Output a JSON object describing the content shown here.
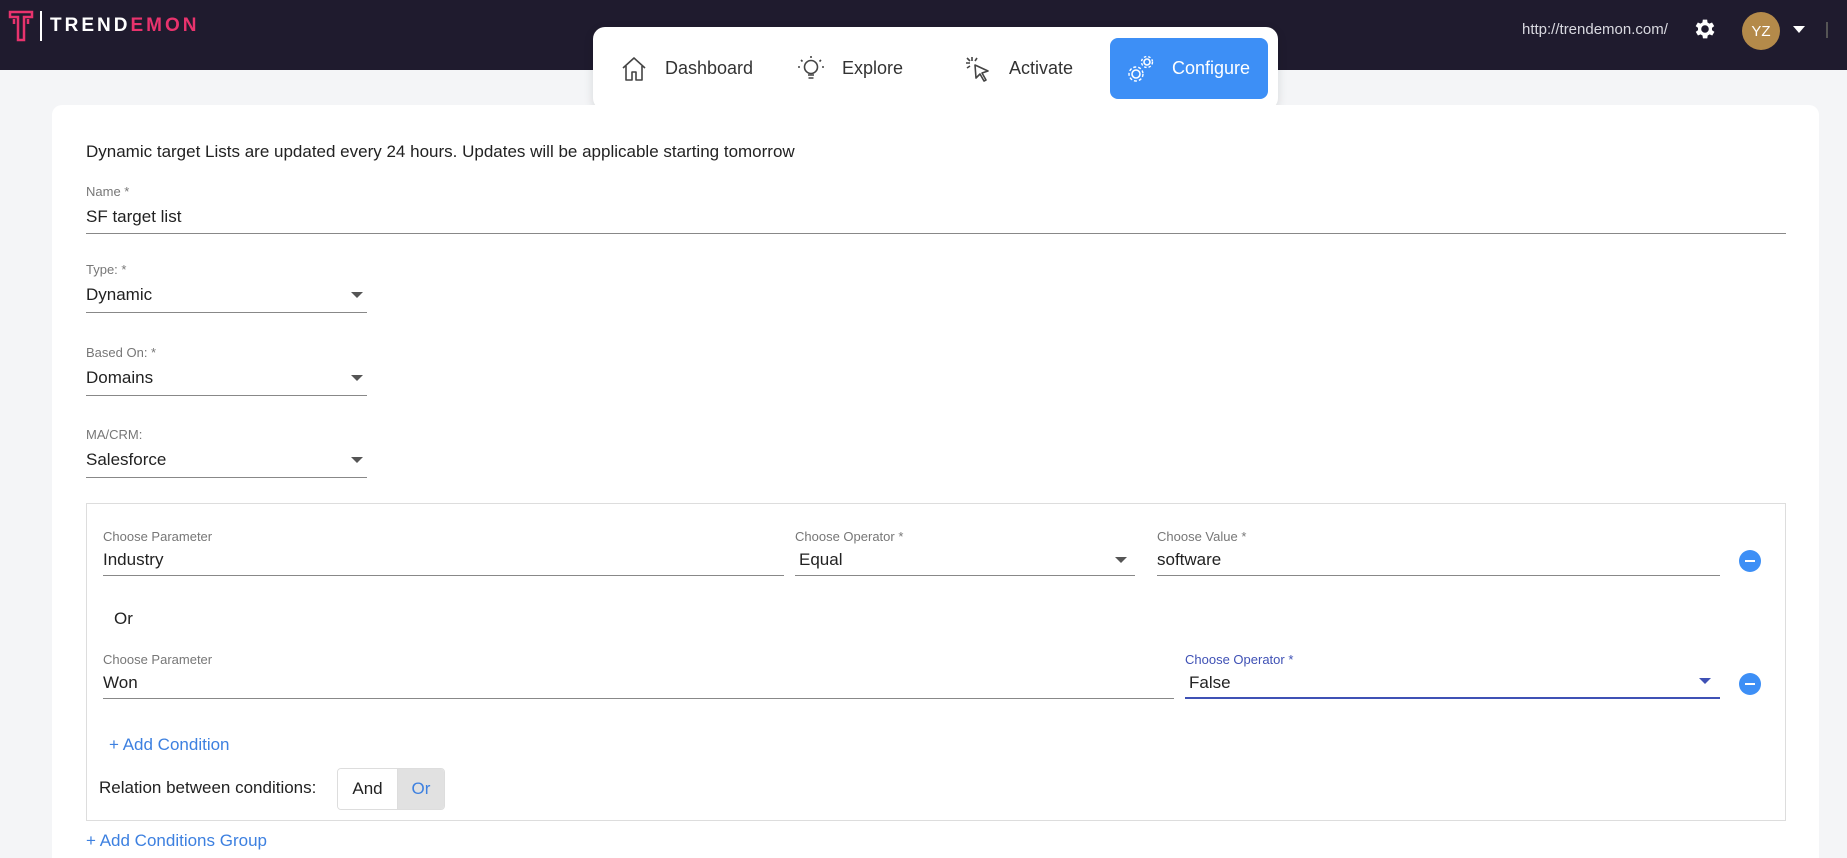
{
  "brand": {
    "name_part1": "TREND",
    "name_part2": "EMON",
    "accent_color": "#e8336d"
  },
  "header": {
    "url": "http://trendemon.com/",
    "avatar_initials": "YZ"
  },
  "nav": {
    "items": [
      {
        "label": "Dashboard",
        "icon": "home-icon"
      },
      {
        "label": "Explore",
        "icon": "lightbulb-icon"
      },
      {
        "label": "Activate",
        "icon": "cursor-click-icon"
      },
      {
        "label": "Configure",
        "icon": "gears-icon",
        "active": true
      }
    ],
    "active_color": "#3d8ff6"
  },
  "form": {
    "info": "Dynamic target Lists are updated every 24 hours. Updates will be applicable starting tomorrow",
    "name": {
      "label": "Name *",
      "value": "SF target list"
    },
    "type": {
      "label": "Type: *",
      "value": "Dynamic"
    },
    "based_on": {
      "label": "Based On: *",
      "value": "Domains"
    },
    "crm": {
      "label": "MA/CRM:",
      "value": "Salesforce"
    },
    "group": {
      "conditions": [
        {
          "param_label": "Choose Parameter",
          "param": "Industry",
          "op_label": "Choose Operator *",
          "op": "Equal",
          "value_label": "Choose Value *",
          "value": "software"
        },
        {
          "param_label": "Choose Parameter",
          "param": "Won",
          "op_label": "Choose Operator *",
          "op": "False"
        }
      ],
      "or_label": "Or",
      "add_condition": "+ Add Condition",
      "relation_label": "Relation between conditions:",
      "relation_and": "And",
      "relation_or": "Or"
    },
    "add_group": "+ Add Conditions Group"
  }
}
